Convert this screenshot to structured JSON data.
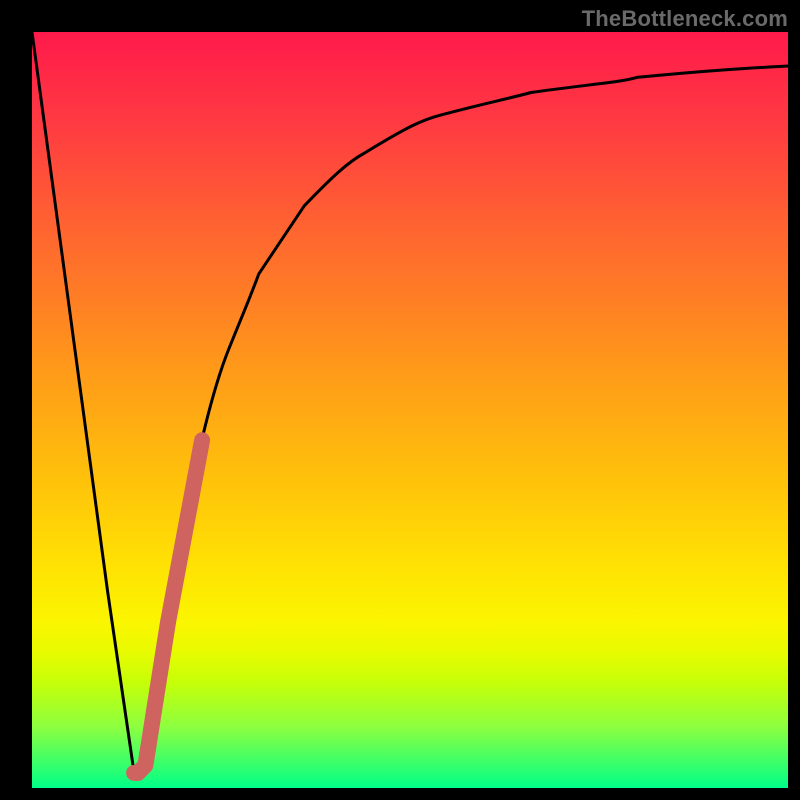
{
  "attribution": "TheBottleneck.com",
  "colors": {
    "accent_stroke": "#ce6360",
    "curve_stroke": "#000000",
    "frame": "#000000"
  },
  "chart_data": {
    "type": "line",
    "title": "",
    "xlabel": "",
    "ylabel": "",
    "xlim": [
      0,
      100
    ],
    "ylim": [
      0,
      100
    ],
    "series": [
      {
        "name": "bottleneck-percentage-curve",
        "x": [
          0,
          5,
          10,
          13.5,
          15,
          18,
          22,
          26,
          30,
          36,
          44,
          54,
          66,
          80,
          100
        ],
        "y": [
          100,
          63,
          26,
          2,
          3,
          22,
          44,
          58,
          68,
          77,
          84,
          89,
          92,
          94,
          95.5
        ]
      },
      {
        "name": "highlighted-segment",
        "x": [
          13.5,
          15,
          18,
          22.5
        ],
        "y": [
          2,
          3,
          22,
          46
        ]
      }
    ],
    "annotations": []
  }
}
